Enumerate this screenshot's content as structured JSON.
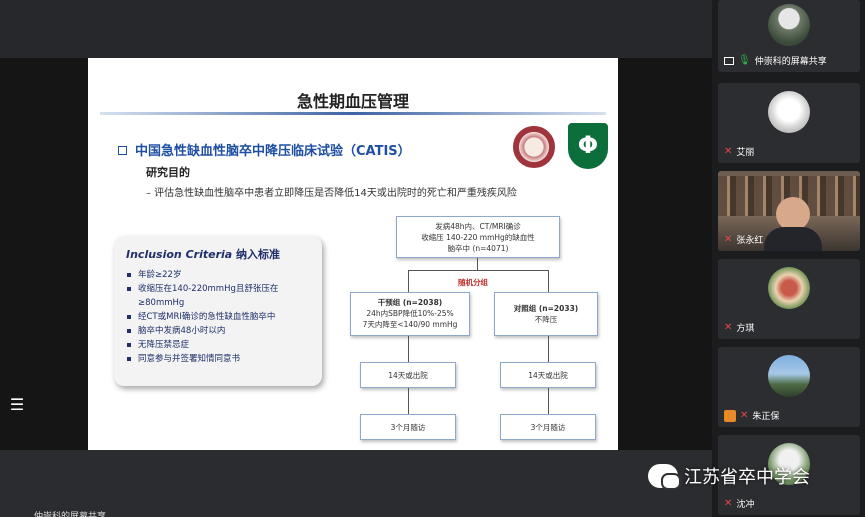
{
  "slide": {
    "title": "急性期血压管理",
    "subtitle": "中国急性缺血性脑卒中降压临床试验（CATIS）",
    "purpose_heading": "研究目的",
    "purpose_text": "–  评估急性缺血性脑卒中患者立即降压是否降低14天或出院时的死亡和严重残疾风险",
    "logo_right_text": "Φ",
    "inclusion": {
      "title_en": "Inclusion Criteria",
      "title_cn": "纳入标准",
      "items": [
        "年龄≥22岁",
        "收缩压在140-220mmHg且舒张压在≥80mmHg",
        "经CT或MRI确诊的急性缺血性脑卒中",
        "脑卒中发病48小时以内",
        "无降压禁忌症",
        "同意参与并签署知情同意书"
      ]
    },
    "flow": {
      "top": [
        "发病48h内、CT/MRI确诊",
        "收缩压 140-220 mmHg的缺血性",
        "脑卒中 (n=4071)"
      ],
      "random": "随机分组",
      "left": [
        "干预组 (n=2038)",
        "24h内SBP降低10%-25%",
        "7天内降至<140/90 mmHg"
      ],
      "right": [
        "对照组 (n=2033)",
        "不降压"
      ],
      "left_follow1": "14天或出院",
      "right_follow1": "14天或出院",
      "left_follow2": "3个月随访",
      "right_follow2": "3个月随访"
    }
  },
  "participants": [
    {
      "name": "仲崇科的屏幕共享",
      "mic": "on",
      "sharing": true
    },
    {
      "name": "艾丽",
      "mic": "muted"
    },
    {
      "name": "张永红",
      "mic": "muted"
    },
    {
      "name": "方琪",
      "mic": "muted"
    },
    {
      "name": "朱正保",
      "mic": "muted",
      "raised": true
    },
    {
      "name": "沈冲",
      "mic": "muted"
    }
  ],
  "watermark": "江苏省卒中学会",
  "bottom_label": "仲崇科的屏幕共享",
  "colors": {
    "accent": "#1f4fa3",
    "random": "#c0302f",
    "panel": "#1b1c1e"
  }
}
